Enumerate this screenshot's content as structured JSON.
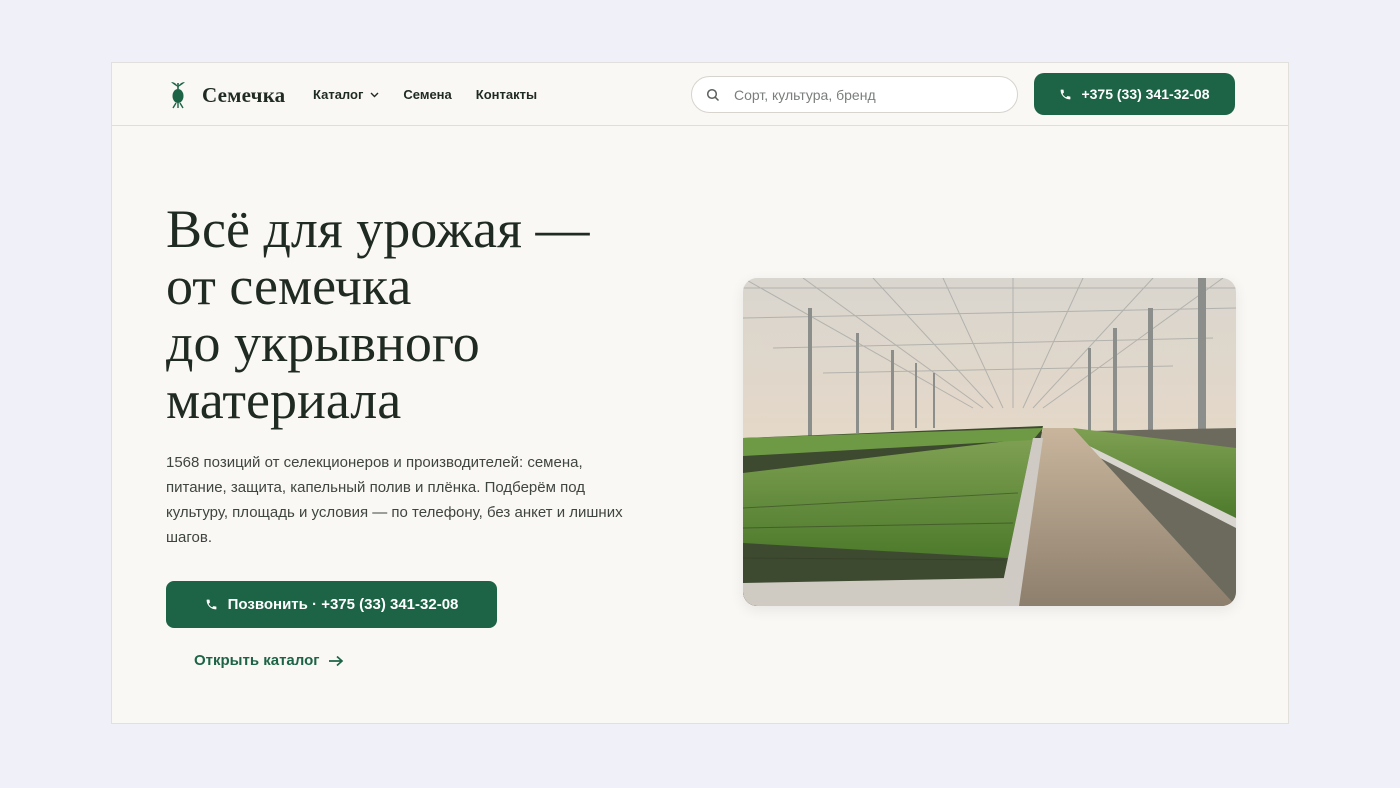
{
  "header": {
    "brand": "Семечка",
    "nav": [
      {
        "label": "Каталог",
        "has_dropdown": true
      },
      {
        "label": "Семена"
      },
      {
        "label": "Контакты"
      }
    ],
    "search_placeholder": "Сорт, культура, бренд",
    "phone": "+375 (33) 341-32-08"
  },
  "hero": {
    "title_lines": [
      "Всё для урожая —",
      "от семечка",
      "до укрывного",
      "материала"
    ],
    "text": "1568 позиций от селекционеров и производителей: семена, питание, защита, капельный полив и плёнка. Подберём под культуру, площадь и условия — по телефону, без анкет и лишних шагов.",
    "cta_label": "Позвонить · +375 (33) 341-32-08",
    "catalog_link": "Открыть каталог"
  },
  "colors": {
    "accent": "#1d6446",
    "text": "#1f2a22",
    "page_bg": "#f0f0f8",
    "card_bg": "#faf8f5"
  },
  "icons": [
    "sprout-logo-icon",
    "chevron-down-icon",
    "search-icon",
    "phone-icon",
    "arrow-right-icon"
  ]
}
